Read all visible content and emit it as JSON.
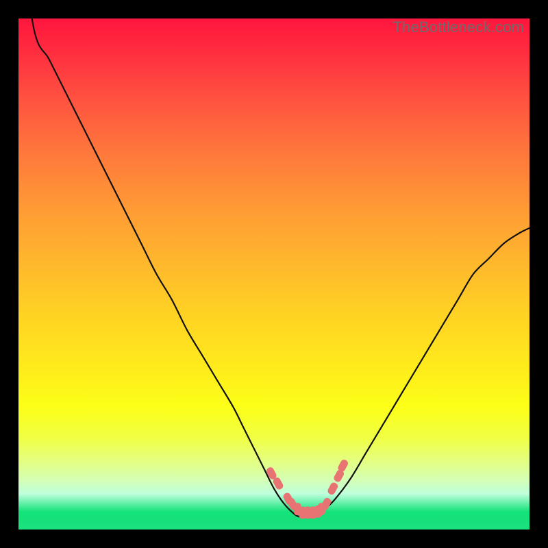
{
  "watermark": {
    "text": "TheBottleneck.com"
  },
  "colors": {
    "frame": "#000000",
    "curve_stroke": "#111111",
    "marker_fill": "#e77373",
    "gradient_stops": [
      "#ff163e",
      "#ff2b3f",
      "#ff5340",
      "#ff7a3b",
      "#ff9a35",
      "#ffb52d",
      "#ffd024",
      "#ffea1c",
      "#fcff18",
      "#f0ff43",
      "#e6ff79",
      "#d6ffb0",
      "#bfffdd",
      "#14e37a",
      "#15e07a",
      "#1be280"
    ]
  },
  "chart_data": {
    "type": "line",
    "title": "",
    "xlabel": "",
    "ylabel": "",
    "xlim": [
      0,
      100
    ],
    "ylim": [
      0,
      100
    ],
    "x": [
      0,
      3,
      6,
      9,
      12,
      15,
      18,
      21,
      24,
      27,
      30,
      33,
      36,
      39,
      42,
      44,
      46,
      48,
      50,
      52,
      54,
      55,
      56,
      57,
      58,
      59,
      60,
      62,
      65,
      68,
      71,
      74,
      77,
      80,
      83,
      86,
      89,
      92,
      95,
      98,
      100
    ],
    "values": [
      120,
      98,
      92,
      86,
      80,
      74,
      68,
      62,
      56,
      50,
      45,
      39,
      34,
      29,
      24,
      20,
      16,
      12,
      8,
      5,
      3,
      2.5,
      2.5,
      2.5,
      2.5,
      3,
      4,
      6,
      10,
      15,
      20,
      25,
      30,
      35,
      40,
      45,
      50,
      53,
      56,
      58,
      59
    ],
    "markers": {
      "x": [
        49.5,
        50.8,
        52.8,
        53.6,
        54.6,
        55.6,
        56.6,
        57.6,
        58.6,
        59.3,
        60.2,
        61.5,
        62.7,
        63.5
      ],
      "y": [
        11,
        9,
        6,
        5,
        4,
        3.3,
        3.3,
        3.3,
        3.5,
        4,
        5,
        8,
        10.5,
        12.5
      ]
    }
  }
}
